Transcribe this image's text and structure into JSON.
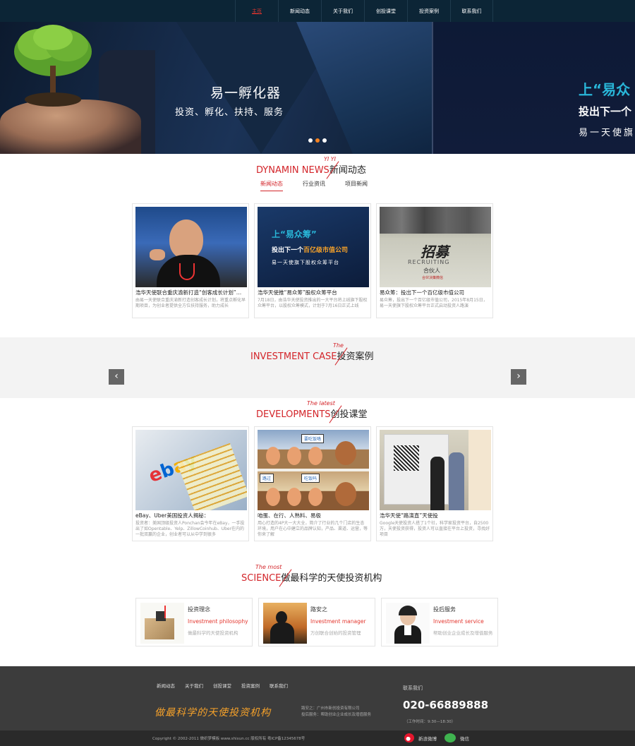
{
  "nav": {
    "items": [
      {
        "label": "主页",
        "active": true
      },
      {
        "label": "新闻动态"
      },
      {
        "label": "关于我们"
      },
      {
        "label": "创投课堂"
      },
      {
        "label": "投资案例"
      },
      {
        "label": "联系我们"
      }
    ]
  },
  "banner": {
    "title": "易一孵化器",
    "subtitle": "投资、孵化、扶持、服务",
    "right_line1": "上“易众",
    "right_line2": "投出下一个",
    "right_line3": "易一天使旗",
    "dots": 3,
    "active_dot": 2
  },
  "news": {
    "title_en": "DYNAMIN NEWS",
    "title_tag": "YI YI",
    "title_cn": "新闻动态",
    "tabs": [
      "新闻动态",
      "行业资讯",
      "项目新闻"
    ],
    "active_tab": 0,
    "cards": [
      {
        "title": "浩华天使联合重庆渝新打造“创客成长计划”…",
        "desc": "由易一天使联合重庆渝新打造创客成长计划，将重点孵化早期项目，为创业者提供全方位扶持服务，助力成长"
      },
      {
        "title": "浩华天使推“易众筹”股权众筹平台",
        "desc": "7月18日，由浩华天使投资推出的一大平台将上线旗下股权众筹平台，以股权众筹模式，计划于7月16日正式上线"
      },
      {
        "title": "易众筹：投出下一个百亿级市值公司",
        "desc": "易众筹，投出下一个百亿级市值公司，2015年8月15日，易一天使旗下股权众筹平台正式启动投资人路演"
      }
    ],
    "card2_banner": {
      "line1": "上“易众筹”",
      "line2": "投出下一个",
      "line2_hl": "百亿级市值公司",
      "line3": "易一天使旗下股权众筹平台"
    },
    "card3_banner": {
      "big": "招募",
      "en": "RECRUITING",
      "sub": "合伙人",
      "small": "合伙决策微信"
    }
  },
  "invest": {
    "title_en": "INVESTMENT CASE",
    "title_tag": "The",
    "title_cn": "投资案例",
    "prev": "‹",
    "next": "›"
  },
  "dev": {
    "title_en": "DEVELOPMENTS",
    "title_tag": "The latest",
    "title_cn": "创投课堂",
    "cards": [
      {
        "title": "eBay、Uber美国投资人揭秘：",
        "desc": "投资者：美国顶级投资人Ponchan会今年在eBay，一手投出了如Opentable、Yelp、ZillowCoinhub、Uber在内的一批双赢的企业，创业者可以从中学到很多"
      },
      {
        "title": "咱蛋、在行、人熟料、易极",
        "desc": "用心打造的4P大一大大全，简介了行业的几个门店的生态环境，用户在心中建立的品牌认知，产品、渠道、运营，等你来了解"
      },
      {
        "title": "浩华天使“路演直”天使投",
        "desc": "Google天使投资人搭了1个社，科学家投资平台，自2500万，天使投资获得，投资人可以直接在平台上投资，寻找好项目"
      }
    ],
    "egg_bubbles": [
      "吃饭吗",
      "路过",
      "要吃饭咯"
    ]
  },
  "science": {
    "title_en": "SCIENCE",
    "title_tag": "The most",
    "title_cn": "做最科学的天使投资机构",
    "features": [
      {
        "title": "投资理念",
        "en": "Investment philosophy",
        "desc": "做最科学的天使投资机构"
      },
      {
        "title": "路安之",
        "en": "Investment manager",
        "desc": "万创联合创始的投资管理"
      },
      {
        "title": "投后服务",
        "en": "Investment service",
        "desc": "帮助创业企业成长及增值服务"
      }
    ]
  },
  "footer": {
    "nav": [
      "新闻动态",
      "关于我们",
      "创投课堂",
      "投资案例",
      "联系我们"
    ],
    "slogan": "做最科学的天使投资机构",
    "info1": "路安之：广州市新创投资有限公司",
    "info2": "投后服务：帮助创业企业成长及增值服务",
    "contact_title": "联系我们",
    "phone": "020-66889888",
    "hours": "（工作时间：9:30—18:30）",
    "copyright": "Copyright © 2002-2011 做织梦模板 www.shixun.cc 版权所有 粤ICP备12345678号",
    "weibo": "新浪微博",
    "wechat": "微信"
  },
  "colors": {
    "nav_bg": "#0c2536",
    "accent": "#d3252a",
    "orange": "#f58220",
    "footer_bg": "#3c3c3c"
  }
}
